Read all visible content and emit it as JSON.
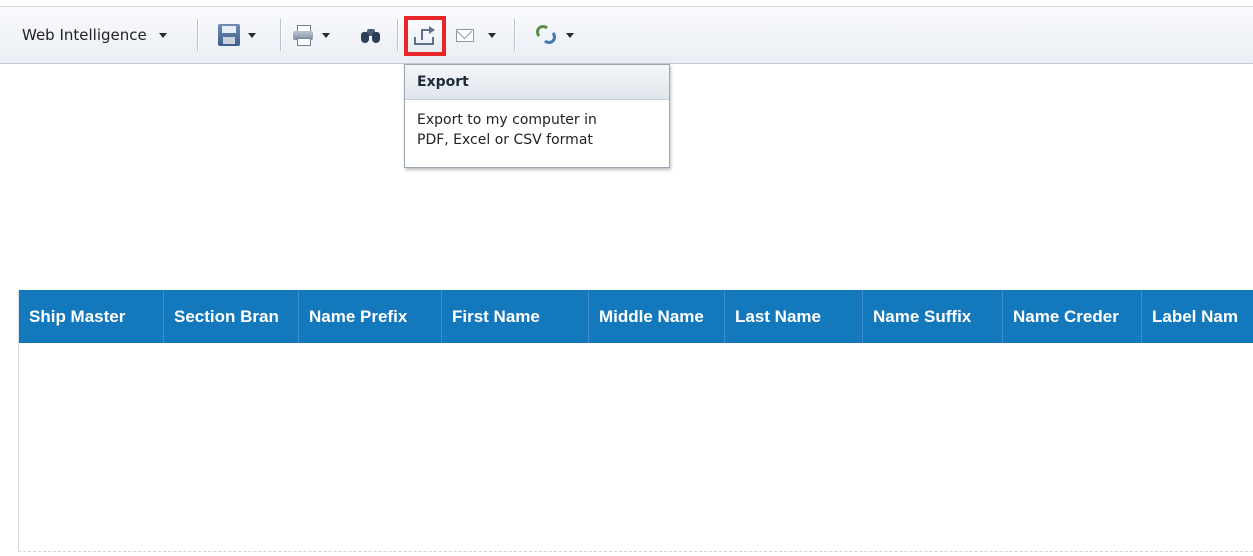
{
  "toolbar": {
    "app_menu_label": "Web Intelligence"
  },
  "tooltip": {
    "title": "Export",
    "line1": "Export to my computer in",
    "line2": "PDF, Excel or CSV format"
  },
  "table": {
    "headers": [
      "Ship Master",
      "Section Bran",
      "Name Prefix",
      "First Name",
      "Middle Name",
      "Last Name",
      "Name Suffix",
      "Name Creder",
      "Label Nam"
    ],
    "header_color": "#1478bd"
  },
  "colors": {
    "highlight": "#e8262a"
  }
}
